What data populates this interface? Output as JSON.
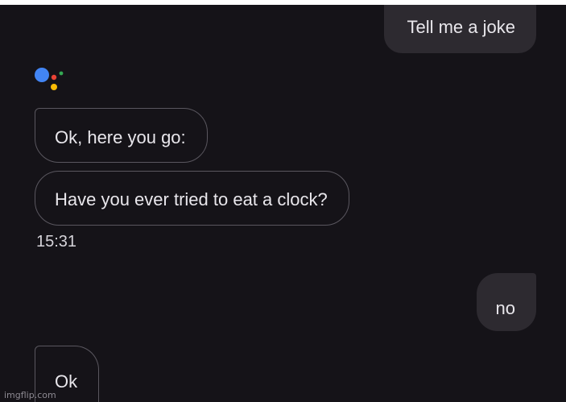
{
  "conversation": {
    "messages": [
      {
        "from": "user",
        "text": "Tell me a joke"
      },
      {
        "from": "assistant",
        "text": "Ok, here you go:"
      },
      {
        "from": "assistant",
        "text": "Have you ever tried to eat a clock?"
      },
      {
        "from": "user",
        "text": "no"
      },
      {
        "from": "assistant",
        "text": "Ok"
      }
    ],
    "timestamp": "15:31"
  },
  "assistant": {
    "icon": "google-assistant-logo-icon",
    "colors": {
      "blue": "#4285f4",
      "red": "#ea4335",
      "yellow": "#fbbc05",
      "green": "#34a853"
    }
  },
  "theme": {
    "background": "#151318",
    "user_bubble": "#2d2a30",
    "assistant_border": "#5a575f",
    "text": "#e9e7ec"
  },
  "watermark": "imgflip.com"
}
